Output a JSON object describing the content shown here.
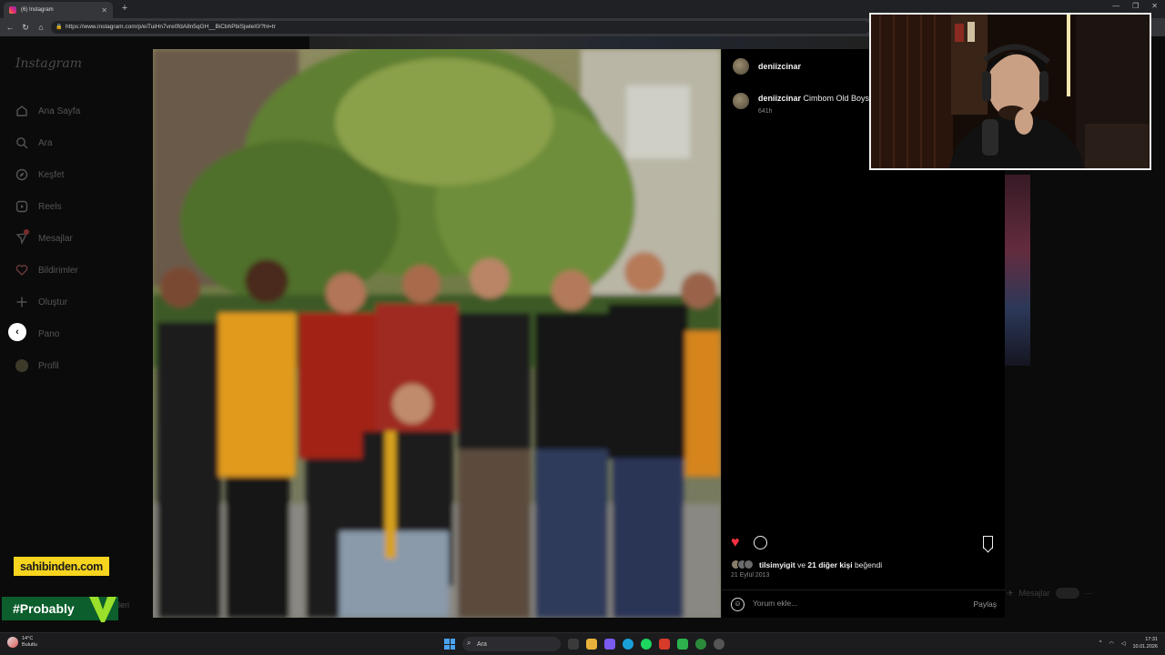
{
  "browser": {
    "tab_title": "(6) Instagram",
    "url": "https://www.instagram.com/p/eiTuiHn7vre0fdA8n5qGH__BiCbhPbiSjwleI0/?hl=tr"
  },
  "sidebar": {
    "logo": "Instagram",
    "items": [
      {
        "label": "Ana Sayfa",
        "icon": "home-icon"
      },
      {
        "label": "Ara",
        "icon": "search-icon"
      },
      {
        "label": "Keşfet",
        "icon": "compass-icon"
      },
      {
        "label": "Reels",
        "icon": "reels-icon"
      },
      {
        "label": "Mesajlar",
        "icon": "messenger-icon"
      },
      {
        "label": "Bildirimler",
        "icon": "heart-icon"
      },
      {
        "label": "Oluştur",
        "icon": "plus-icon"
      },
      {
        "label": "Pano",
        "icon": "dashboard-icon"
      },
      {
        "label": "Profil",
        "icon": "avatar"
      }
    ]
  },
  "post": {
    "username": "deniizcinar",
    "caption_user": "deniizcinar",
    "caption": "Cimbom Old Boys",
    "caption_time": "641h",
    "liked_by": "tilsimyigit",
    "likes_connector": "ve",
    "likes_others": "21 diğer kişi",
    "likes_suffix": "beğendi",
    "date": "21 Eylül 2013",
    "comment_placeholder": "Yorum ekle...",
    "share_label": "Paylaş"
  },
  "mini_messages": {
    "label": "Mesajlar"
  },
  "overlays": {
    "sponsor": "sahibinden.com",
    "hashtag": "#Probably",
    "behind_text": "leri"
  },
  "taskbar": {
    "weather_temp": "14°C",
    "weather_desc": "Bulutlu",
    "search_label": "Ara",
    "time": "17:31",
    "date": "10.01.2026"
  },
  "colors": {
    "like": "#ff3040",
    "sponsor_bg": "#f7d41e",
    "hashtag_bg": "#0c5e2c"
  }
}
